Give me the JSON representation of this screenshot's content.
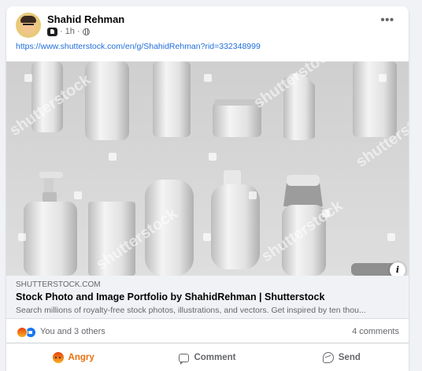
{
  "post": {
    "author": "Shahid Rehman",
    "time": "1h",
    "separator": "·",
    "more_label": "•••",
    "link_text": "https://www.shutterstock.com/en/g/ShahidRehman?rid=332348999"
  },
  "preview": {
    "watermark": "shutterstock",
    "info_label": "i",
    "domain": "SHUTTERSTOCK.COM",
    "title": "Stock Photo and Image Portfolio by ShahidRehman | Shutterstock",
    "description": "Search millions of royalty-free stock photos, illustrations, and vectors. Get inspired by ten thou..."
  },
  "stats": {
    "reactions_text": "You and 3 others",
    "comments_text": "4 comments",
    "reaction_icons": [
      "angry-icon",
      "like-icon"
    ]
  },
  "actions": {
    "angry_label": "Angry",
    "comment_label": "Comment",
    "send_label": "Send"
  },
  "colors": {
    "link": "#216fdb",
    "angry": "#e9710f",
    "like": "#1877f2",
    "muted": "#65676b"
  }
}
